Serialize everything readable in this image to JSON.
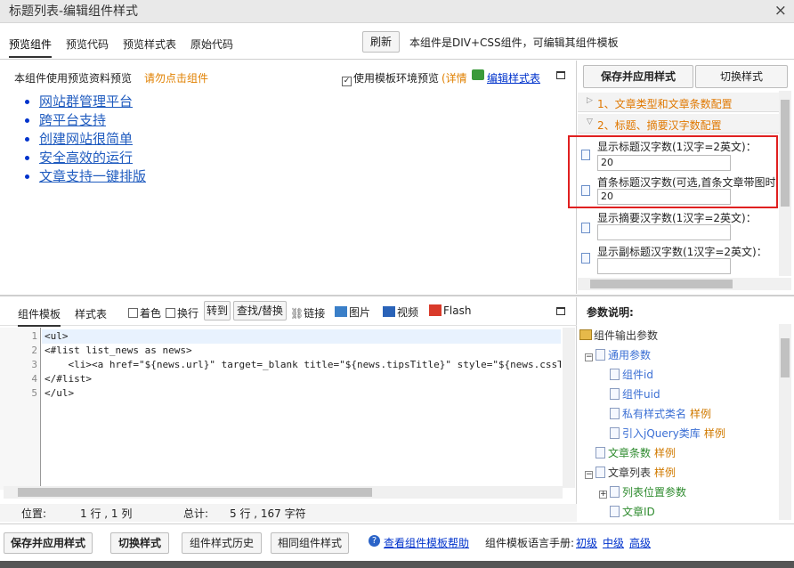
{
  "window": {
    "title": "标题列表-编辑组件样式",
    "close_glyph": "×"
  },
  "tabs": [
    {
      "label": "预览组件"
    },
    {
      "label": "预览代码"
    },
    {
      "label": "预览样式表"
    },
    {
      "label": "原始代码"
    }
  ],
  "topbar": {
    "refresh_label": "刷新",
    "info_text": "本组件是DIV+CSS组件，可编辑其组件模板"
  },
  "preview": {
    "header_text": "本组件使用预览资料预览",
    "warning_text": "请勿点击组件",
    "use_template_env_label": "使用模板环境预览",
    "detail_label": "(详情",
    "edit_stylesheet_label": "编辑样式表",
    "items": [
      "网站群管理平台",
      "跨平台支持",
      "创建网站很简单",
      "安全高效的运行",
      "文章支持一键排版"
    ]
  },
  "config_panel": {
    "save_apply_label": "保存并应用样式",
    "switch_style_label": "切换样式",
    "sections": [
      {
        "label": "1、文章类型和文章条数配置"
      },
      {
        "label": "2、标题、摘要汉字数配置"
      }
    ],
    "fields": [
      {
        "label": "显示标题汉字数(1汉字=2英文)：",
        "value": "20"
      },
      {
        "label": "首条标题汉字数(可选,首条文章带图时",
        "value": "20"
      },
      {
        "label": "显示摘要汉字数(1汉字=2英文)：",
        "value": ""
      },
      {
        "label": "显示副标题汉字数(1汉字=2英文)：",
        "value": ""
      }
    ]
  },
  "editor": {
    "tab_template": "组件模板",
    "tab_stylesheet": "样式表",
    "tools": {
      "color": "着色",
      "wrap": "换行",
      "goto": "转到",
      "find_replace": "查找/替换",
      "link": "链接",
      "image": "图片",
      "video": "视频",
      "flash": "Flash"
    },
    "lines": [
      {
        "n": "1",
        "text": "<ul>"
      },
      {
        "n": "2",
        "text": "<#list list_news as news>"
      },
      {
        "n": "3",
        "text": "    <li><a href=\"${news.url}\" target=_blank title=\"${news.tipsTitle}\" style=\"${news.cssT"
      },
      {
        "n": "4",
        "text": "</#list>"
      },
      {
        "n": "5",
        "text": "</ul>"
      }
    ],
    "status": {
      "position_label": "位置:",
      "position_value": "1 行 , 1 列",
      "total_label": "总计:",
      "total_value": "5 行 , 167 字符"
    }
  },
  "params": {
    "title": "参数说明:",
    "tree": [
      {
        "label": "组件输出参数",
        "level": 0,
        "style": "nm",
        "sample": ""
      },
      {
        "label": "通用参数",
        "level": 1,
        "style": "blue",
        "sample": ""
      },
      {
        "label": "组件id",
        "level": 2,
        "style": "blue",
        "sample": ""
      },
      {
        "label": "组件uid",
        "level": 2,
        "style": "blue",
        "sample": ""
      },
      {
        "label": "私有样式类名",
        "level": 2,
        "style": "blue",
        "sample": "样例"
      },
      {
        "label": "引入jQuery类库",
        "level": 2,
        "style": "blue",
        "sample": "样例"
      },
      {
        "label": "文章条数",
        "level": 1,
        "style": "green",
        "sample": "样例"
      },
      {
        "label": "文章列表",
        "level": 1,
        "style": "nm",
        "sample": "样例"
      },
      {
        "label": "列表位置参数",
        "level": 2,
        "style": "green",
        "sample": ""
      },
      {
        "label": "文章ID",
        "level": 2,
        "style": "green",
        "sample": ""
      }
    ]
  },
  "footer": {
    "save_apply_label": "保存并应用样式",
    "switch_style_label": "切换样式",
    "history_label": "组件样式历史",
    "similar_label": "相同组件样式",
    "help_link": "查看组件模板帮助",
    "manual_label": "组件模板语言手册:",
    "basic": "初级",
    "intermediate": "中级",
    "advanced": "高级"
  },
  "colors": {
    "accent_orange": "#e07800",
    "link_blue": "#0033cc",
    "highlight_red": "#e02020"
  }
}
